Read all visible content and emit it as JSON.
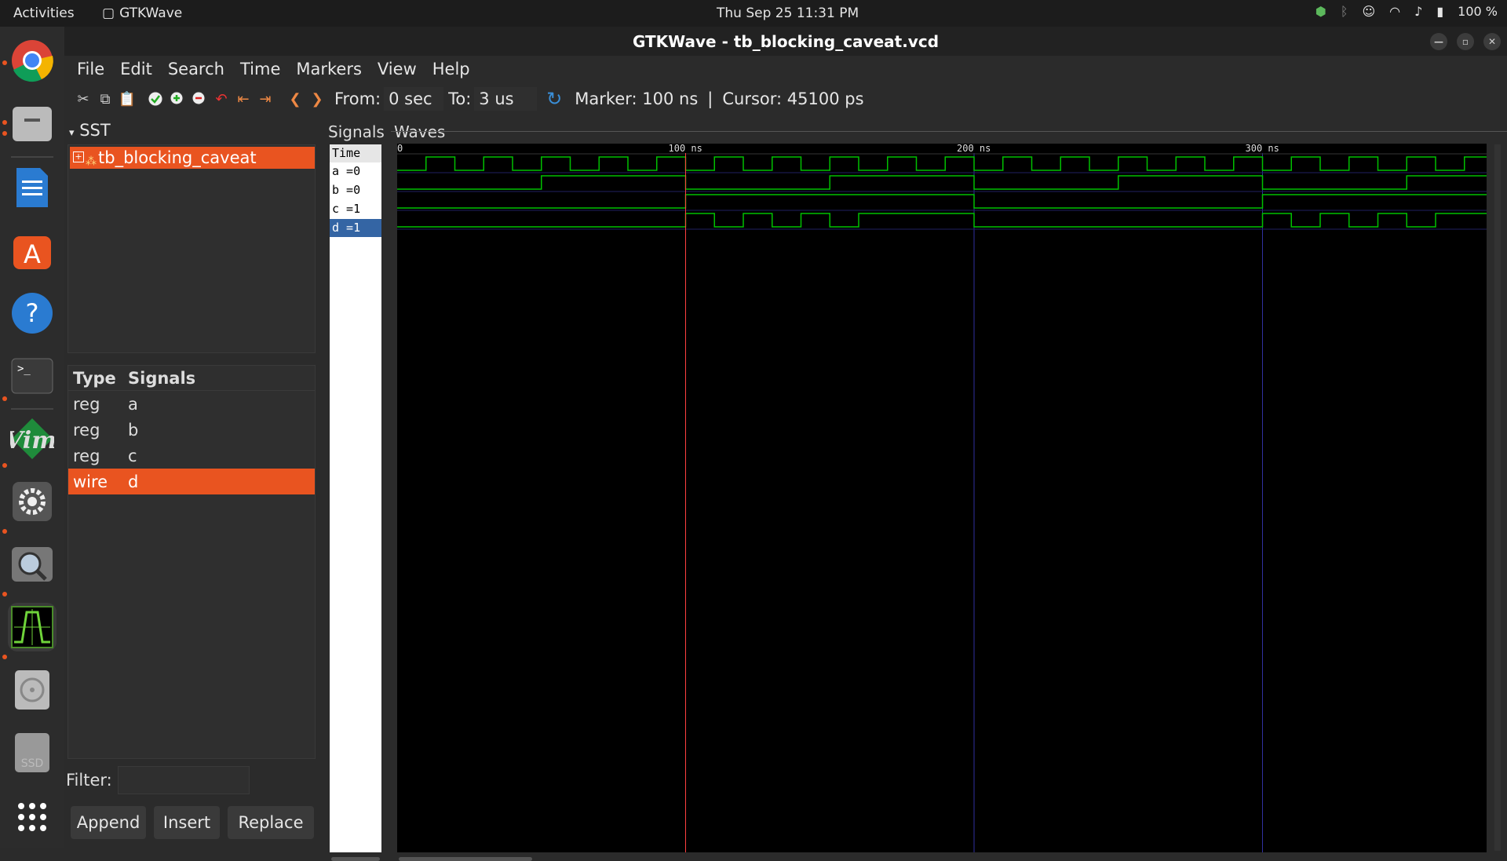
{
  "topbar": {
    "activities": "Activities",
    "app_name": "GTKWave",
    "clock": "Thu Sep 25  11:31 PM",
    "battery": "100 %"
  },
  "dock": {
    "items": [
      "chrome-icon",
      "files-icon",
      "writer-icon",
      "app-center-icon",
      "help-icon",
      "terminal-icon",
      "vim-icon",
      "settings-icon",
      "image-viewer-icon",
      "gtkwave-icon",
      "disc-icon",
      "ssd-icon",
      "show-apps-icon"
    ],
    "accent": "#e95420"
  },
  "window": {
    "title": "GTKWave - tb_blocking_caveat.vcd",
    "menu": [
      "File",
      "Edit",
      "Search",
      "Time",
      "Markers",
      "View",
      "Help"
    ],
    "toolbar": {
      "from_label": "From:",
      "from_value": "0 sec",
      "to_label": "To:",
      "to_value": "3 us",
      "marker_text": "Marker: 100 ns",
      "separator": "|",
      "cursor_text": "Cursor: 45100 ps"
    }
  },
  "sst": {
    "header": "SST",
    "tree_item": "tb_blocking_caveat"
  },
  "signal_list": {
    "col_type": "Type",
    "col_signals": "Signals",
    "rows": [
      {
        "type": "reg",
        "name": "a"
      },
      {
        "type": "reg",
        "name": "b"
      },
      {
        "type": "reg",
        "name": "c"
      },
      {
        "type": "wire",
        "name": "d",
        "selected": true
      }
    ]
  },
  "filter": {
    "label": "Filter:",
    "value": ""
  },
  "buttons": {
    "append": "Append",
    "insert": "Insert",
    "replace": "Replace"
  },
  "signals_pane": {
    "label": "Signals",
    "entries": [
      "Time",
      "a =0",
      "b =0",
      "c =1",
      "d =1"
    ]
  },
  "waves_pane": {
    "label": "Waves",
    "ticks": [
      {
        "value": 0,
        "label": "0"
      },
      {
        "value": 100,
        "label": "100 ns"
      },
      {
        "value": 200,
        "label": "200 ns"
      },
      {
        "value": 300,
        "label": "300 ns"
      }
    ],
    "range_ns": [
      0,
      378
    ],
    "marker_ns": 100,
    "wave_color": "#00c000",
    "marker_color": "#ff4040",
    "grid_color": "#3030a0",
    "signals": {
      "a": {
        "period": 20,
        "half": 10,
        "initial": 0
      },
      "b": {
        "transitions": [
          [
            0,
            0
          ],
          [
            50,
            1
          ],
          [
            100,
            0
          ],
          [
            150,
            1
          ],
          [
            200,
            0
          ],
          [
            250,
            1
          ],
          [
            300,
            0
          ],
          [
            350,
            1
          ]
        ]
      },
      "c": {
        "transitions": [
          [
            0,
            0
          ],
          [
            100,
            1
          ],
          [
            200,
            0
          ],
          [
            300,
            1
          ]
        ]
      },
      "d": {
        "transitions": [
          [
            0,
            0
          ],
          [
            100,
            1
          ],
          [
            110,
            0
          ],
          [
            120,
            1
          ],
          [
            130,
            0
          ],
          [
            140,
            1
          ],
          [
            150,
            0
          ],
          [
            160,
            1
          ],
          [
            200,
            0
          ],
          [
            300,
            1
          ],
          [
            310,
            0
          ],
          [
            320,
            1
          ],
          [
            330,
            0
          ],
          [
            340,
            1
          ],
          [
            350,
            0
          ],
          [
            360,
            1
          ]
        ]
      }
    }
  }
}
